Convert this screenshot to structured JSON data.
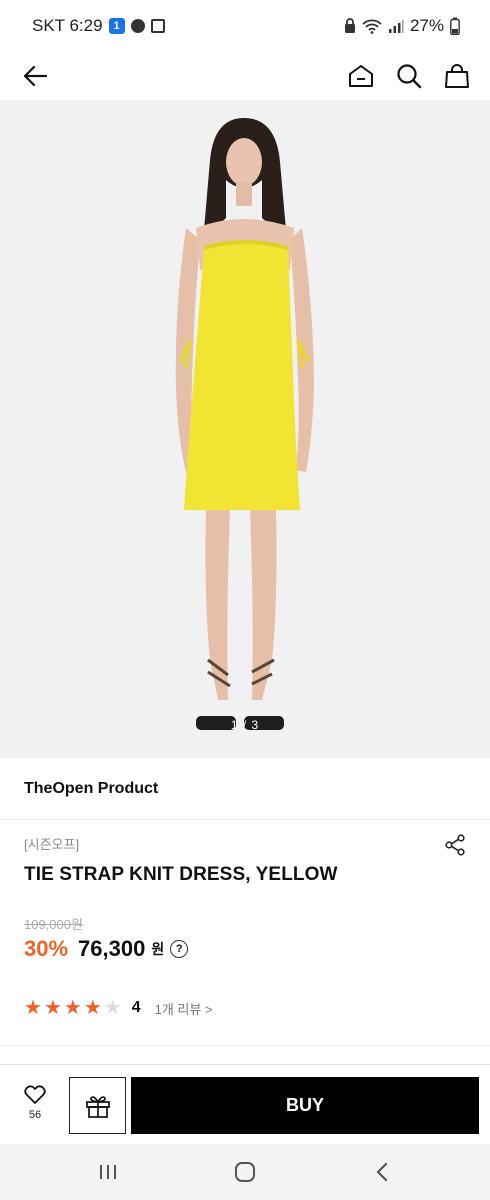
{
  "status_bar": {
    "carrier_time": "SKT 6:29",
    "app_badge": "1",
    "battery": "27%",
    "icons": [
      "app-badge-icon",
      "chat-bubble-icon",
      "square-notification-icon",
      "lock-icon",
      "wifi-icon",
      "signal-icon",
      "battery-icon"
    ]
  },
  "nav": {
    "icons": [
      "back-arrow-icon",
      "home-icon",
      "search-icon",
      "shopping-bag-icon"
    ]
  },
  "hero": {
    "counter": "1 / 3",
    "dress_color": "#f2e432",
    "background": "#f1f1f1"
  },
  "brand": {
    "name": "TheOpen Product"
  },
  "product": {
    "season_tag": "[시즌오프]",
    "title": "TIE STRAP KNIT DRESS, YELLOW",
    "original_price": "109,000원",
    "discount": "30%",
    "sale_price": "76,300",
    "currency": "원",
    "help": "?"
  },
  "rating": {
    "stars": 4,
    "max_stars": 5,
    "score": "4",
    "reviews": "1개 리뷰 >"
  },
  "actions": {
    "like_count": "56",
    "buy_label": "BUY",
    "icons": [
      "heart-icon",
      "gift-icon"
    ]
  },
  "system_nav": {
    "icons": [
      "recents-icon",
      "home-circle-icon",
      "back-chevron-icon"
    ]
  },
  "colors": {
    "accent": "#f0622a",
    "buy_background": "#000000",
    "star_inactive": "#dddddd"
  }
}
